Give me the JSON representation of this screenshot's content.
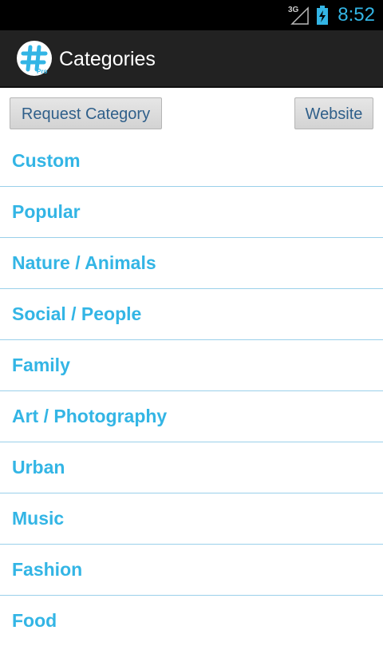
{
  "status_bar": {
    "network": "3G",
    "time": "8:52"
  },
  "action_bar": {
    "title": "Categories",
    "icon_badge": "Pro"
  },
  "buttons": {
    "request": "Request Category",
    "website": "Website"
  },
  "categories": [
    "Custom",
    "Popular",
    "Nature / Animals",
    "Social / People",
    "Family",
    "Art / Photography",
    "Urban",
    "Music",
    "Fashion",
    "Food"
  ],
  "colors": {
    "accent": "#33b5e5",
    "divider": "#9ad0ea",
    "action_bar": "#222222"
  }
}
